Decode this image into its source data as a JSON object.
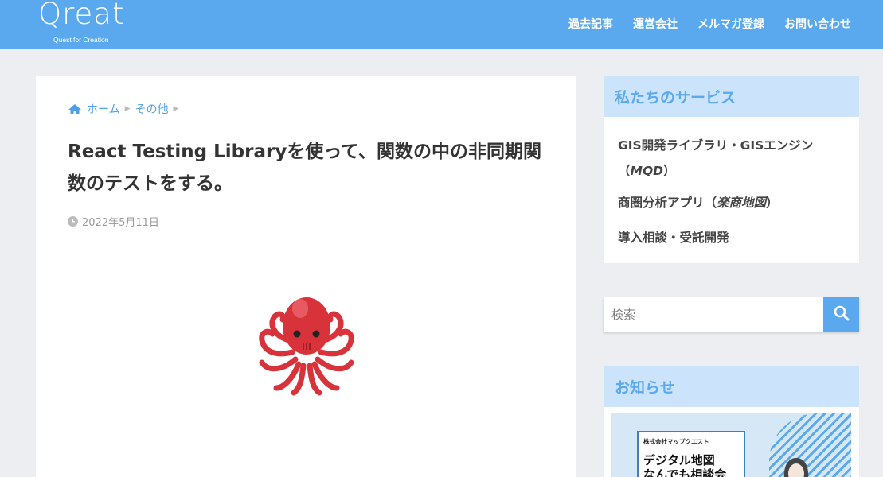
{
  "header": {
    "logo": "Qreat",
    "logo_tagline": "Quest for Creation",
    "nav": [
      "過去記事",
      "運営会社",
      "メルマガ登録",
      "お問い合わせ"
    ]
  },
  "breadcrumb": {
    "home": "ホーム",
    "category": "その他"
  },
  "post": {
    "title": "React Testing Libraryを使って、関数の中の非同期関数のテストをする。",
    "date": "2022年5月11日",
    "image_icon": "octopus-icon"
  },
  "sidebar": {
    "services_title": "私たちのサービス",
    "services": [
      {
        "text": "GIS開発ライブラリ・GISエンジン（",
        "em": "MQD",
        "end": "）"
      },
      {
        "text": "商圏分析アプリ（",
        "em": "楽商地図",
        "end": "）"
      },
      {
        "text": "導入相談・受託開発",
        "em": "",
        "end": ""
      }
    ],
    "search_placeholder": "検索",
    "news_title": "お知らせ",
    "banner_company": "株式会社マップクエスト",
    "banner_line1": "デジタル地図",
    "banner_line2": "なんでも相談会"
  },
  "colors": {
    "accent": "#5aa9ee",
    "widget_header_bg": "#cbe4fb",
    "page_bg": "#eceef1"
  }
}
